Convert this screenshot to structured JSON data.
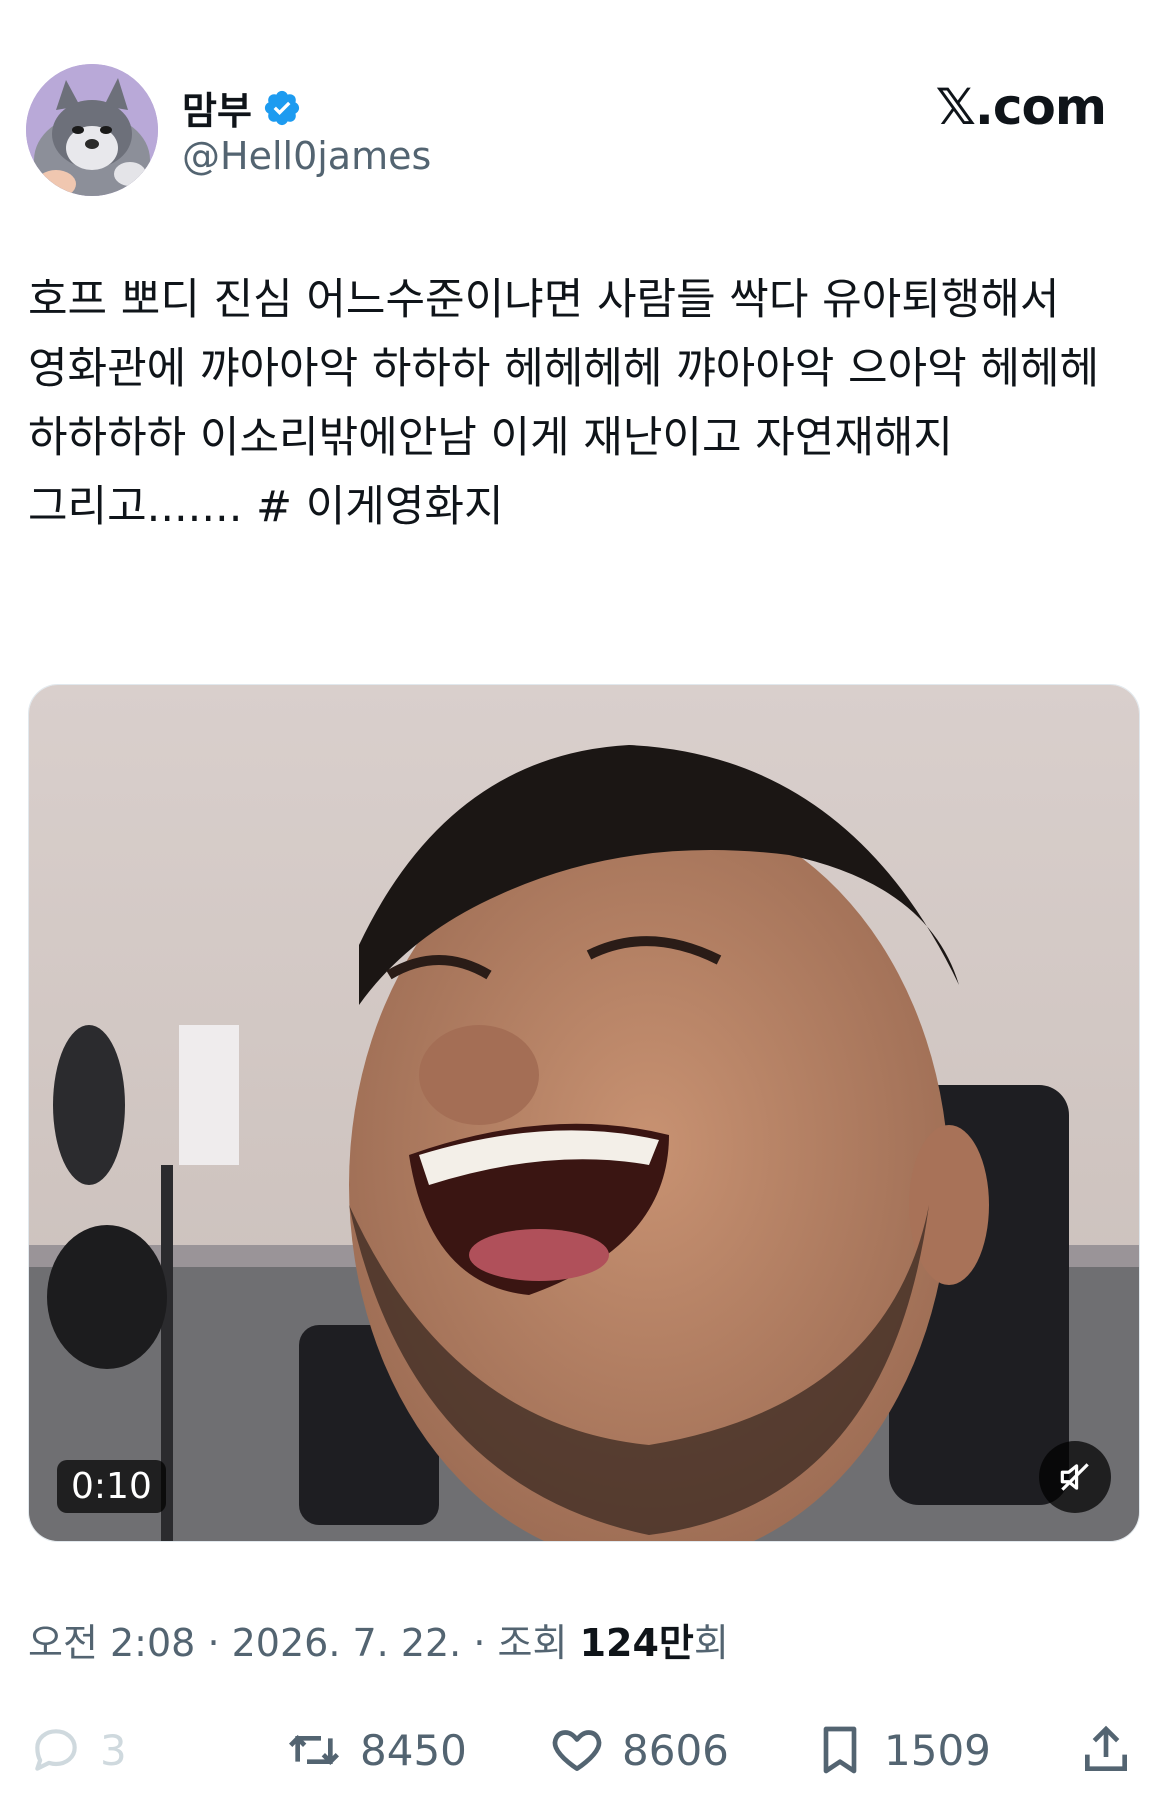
{
  "header": {
    "display_name": "맘부",
    "handle": "@Hell0james",
    "brand": "𝕏.com"
  },
  "tweet": {
    "text": "호프 뽀디 진심 어느수준이냐면 사람들 싹다 유아퇴행해서 영화관에 꺄아아악 하하하 헤헤헤헤 꺄아아악 으아악 헤헤헤 하하하하 이소리밖에안남 이게 재난이고 자연재해지\n그리고....... # 이게영화지",
    "hashtag": "# 이게영화지"
  },
  "media": {
    "duration": "0:10",
    "mute_icon": "speaker-muted-icon"
  },
  "meta": {
    "time": "오전 2:08",
    "separator": "·",
    "date": "2026. 7. 22.",
    "views_prefix": "조회",
    "views_count": "124만",
    "views_suffix": "회"
  },
  "actions": {
    "reply_count": "3",
    "retweet_count": "8450",
    "like_count": "8606",
    "bookmark_count": "1509"
  },
  "colors": {
    "verified": "#1d9bf0",
    "text": "#0f1419",
    "secondary": "#536471",
    "avatar_bg": "#b7a7d6"
  }
}
